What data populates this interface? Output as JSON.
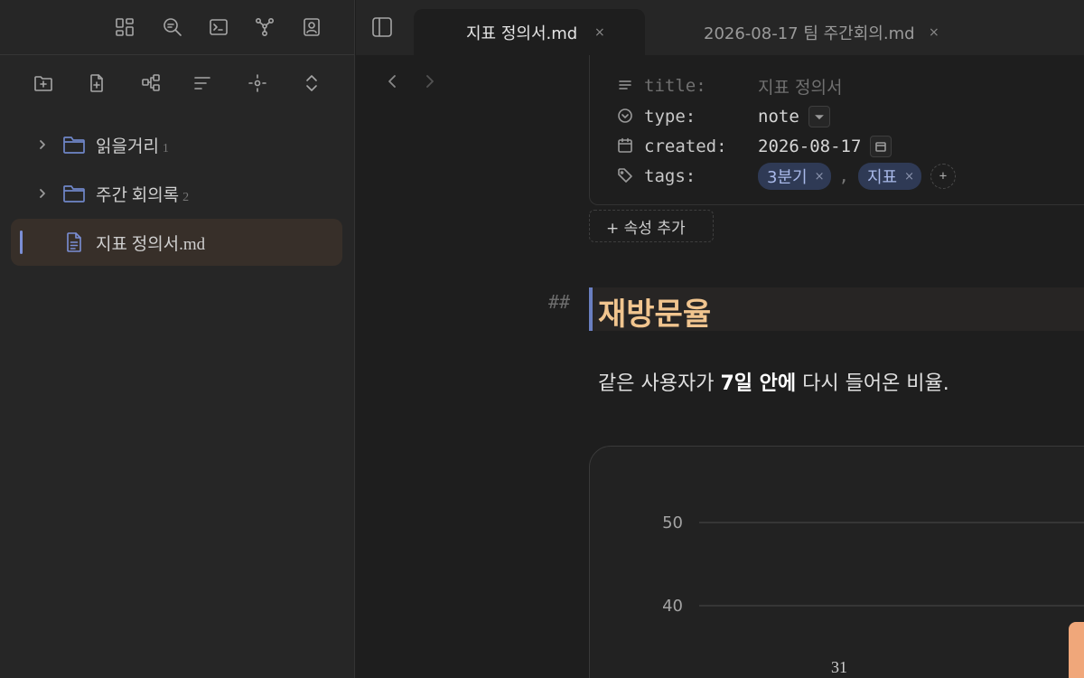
{
  "sidebar": {
    "top_icons": [
      "dashboard-icon",
      "search-zoom-icon",
      "terminal-icon",
      "graph-icon",
      "contact-icon"
    ],
    "tool_icons": [
      "new-folder-icon",
      "new-file-icon",
      "tree-view-icon",
      "sort-icon",
      "locate-icon",
      "expand-collapse-icon"
    ],
    "items": [
      {
        "label": "읽을거리",
        "count": "1",
        "type": "folder"
      },
      {
        "label": "주간 회의록",
        "count": "2",
        "type": "folder"
      },
      {
        "label": "지표 정의서.md",
        "type": "file",
        "active": true
      }
    ]
  },
  "tabs": [
    {
      "label": "지표 정의서.md",
      "close": "×",
      "active": true
    },
    {
      "label": "2026-08-17 팀 주간회의.md",
      "close": "×",
      "active": false
    }
  ],
  "properties": {
    "title": {
      "key": "title:",
      "value": "지표 정의서"
    },
    "type": {
      "key": "type:",
      "value": "note"
    },
    "created": {
      "key": "created:",
      "value": "2026-08-17"
    },
    "tags": {
      "key": "tags:",
      "values": [
        "3분기",
        "지표"
      ],
      "remove": "×",
      "separator": ",",
      "add": "+"
    }
  },
  "add_property_label": "+ 속성 추가",
  "heading": {
    "marker": "##",
    "text": "재방문율"
  },
  "paragraph": {
    "before": "같은 사용자가 ",
    "bold": "7일 안에",
    "after": " 다시 들어온 비율."
  },
  "colors": {
    "accent": "#6a7fc1",
    "heading": "#f1c58f",
    "bar": "#f0a77a"
  },
  "chart_data": {
    "type": "bar",
    "y_ticks": [
      50,
      40
    ],
    "values": [
      31
    ],
    "data_labels": [
      "31"
    ],
    "grid": true
  }
}
